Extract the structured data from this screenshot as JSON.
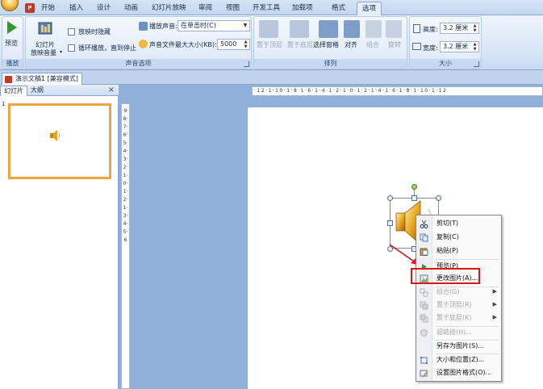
{
  "tabs": [
    "开始",
    "插入",
    "设计",
    "动画",
    "幻灯片放映",
    "审阅",
    "视图",
    "开发工具",
    "加载项",
    "格式",
    "选项"
  ],
  "active_tab": "选项",
  "ribbon": {
    "play_group": {
      "preview_label": "预览",
      "group_label": "播放"
    },
    "sound_group": {
      "slide_volume_label1": "幻灯片",
      "slide_volume_label2": "放映音量",
      "hide_label": "放映时隐藏",
      "loop_label": "循环播放，直到停止",
      "play_sound_label": "播放声音:",
      "play_sound_value": "在单击时(C)",
      "max_size_label": "声音文件最大大小(KB):",
      "max_size_value": "5000",
      "group_label": "声音选项"
    },
    "arrange_group": {
      "bring_front": "置于顶层",
      "send_back": "置于底层",
      "selection_pane": "选择窗格",
      "align": "对齐",
      "group": "组合",
      "rotate": "旋转",
      "group_label": "排列"
    },
    "size_group": {
      "height_label": "高度:",
      "height_value": "3.2 厘米",
      "width_label": "宽度:",
      "width_value": "3.2 厘米",
      "group_label": "大小"
    }
  },
  "doc_tab": "演示文稿1 [兼容模式]",
  "panel": {
    "slides_tab": "幻灯片",
    "outline_tab": "大纲",
    "close": "×",
    "slide_number": "1"
  },
  "hruler_text": "·12·1·10·1·8·1·6·1·4·1·2·1·0·1·2·1·4·1·6·1·8·1·10·1·12",
  "vruler_text": "·9·8·7·6·5·4·3·2·1·0·1·2·1·3·4·5·6",
  "context_menu": {
    "cut": "剪切(T)",
    "copy": "复制(C)",
    "paste": "粘贴(P)",
    "preview": "预览(P)",
    "change_picture": "更改图片(A)...",
    "group": "组合(G)",
    "bring_front": "置于顶层(R)",
    "send_back": "置于底层(K)",
    "hyperlink": "超链接(H)...",
    "save_as_picture": "另存为图片(S)...",
    "size_position": "大小和位置(Z)...",
    "format_picture": "设置图片格式(O)..."
  },
  "colors": {
    "highlight": "#e0141b",
    "arrow": "#e0141b",
    "thumb_border": "#f0a640"
  }
}
